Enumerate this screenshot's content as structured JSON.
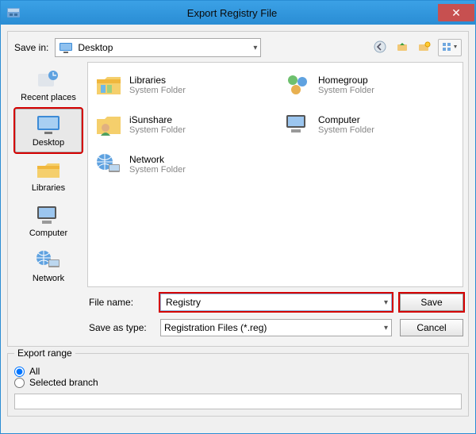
{
  "window": {
    "title": "Export Registry File"
  },
  "savein": {
    "label": "Save in:",
    "value": "Desktop"
  },
  "places": {
    "items": [
      {
        "label": "Recent places"
      },
      {
        "label": "Desktop"
      },
      {
        "label": "Libraries"
      },
      {
        "label": "Computer"
      },
      {
        "label": "Network"
      }
    ]
  },
  "items": [
    {
      "name": "Libraries",
      "type": "System Folder"
    },
    {
      "name": "Homegroup",
      "type": "System Folder"
    },
    {
      "name": "iSunshare",
      "type": "System Folder"
    },
    {
      "name": "Computer",
      "type": "System Folder"
    },
    {
      "name": "Network",
      "type": "System Folder"
    }
  ],
  "file": {
    "name_label": "File name:",
    "name_value": "Registry",
    "type_label": "Save as type:",
    "type_value": "Registration Files (*.reg)"
  },
  "buttons": {
    "save": "Save",
    "cancel": "Cancel"
  },
  "export_range": {
    "group": "Export range",
    "all": "All",
    "selected": "Selected branch",
    "branch_value": ""
  }
}
